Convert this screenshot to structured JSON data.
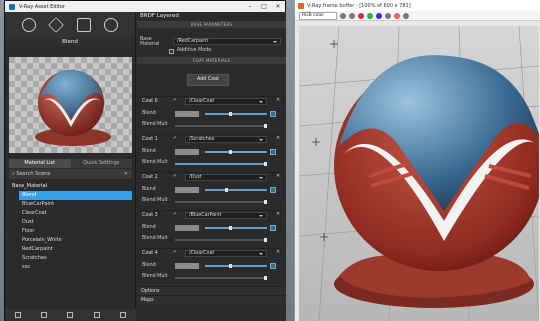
{
  "asset_editor": {
    "title": "V-Ray Asset Editor",
    "material_name": "Blend",
    "tabs": [
      "Material List",
      "Quick Settings"
    ],
    "search_placeholder": "Search Scene",
    "list_group": "Base_Material",
    "materials": [
      "Blend",
      "BlueCarPaint",
      "ClearCoat",
      "Dust",
      "Floor",
      "Porcelain_White",
      "RedCarpaint",
      "Scratches",
      "sss"
    ],
    "selected": "Blend"
  },
  "brdf": {
    "header": "BRDF Layered",
    "section_base": "BASE PARAMETERS",
    "base_material_label": "Base Material",
    "base_material_value": "/RedCarpaint",
    "additive_label": "Additive Mode",
    "section_coat": "COAT MATERIALS",
    "add_coat_label": "Add Coat",
    "blend_label": "Blend",
    "blend_mult_label": "Blend Mult",
    "coats": [
      {
        "name": "Coat 0",
        "material": "/ClearCoat"
      },
      {
        "name": "Coat 1",
        "material": "/Scratches"
      },
      {
        "name": "Coat 2",
        "material": "/Dust"
      },
      {
        "name": "Coat 3",
        "material": "/BlueCarPaint"
      },
      {
        "name": "Coat 4",
        "material": "/ClearCoat"
      }
    ],
    "options_label": "Options",
    "maps_label": "Maps"
  },
  "frame_buffer": {
    "title": "V-Ray frame buffer - [100% of 600 x 781]",
    "channel": "RGB color"
  }
}
